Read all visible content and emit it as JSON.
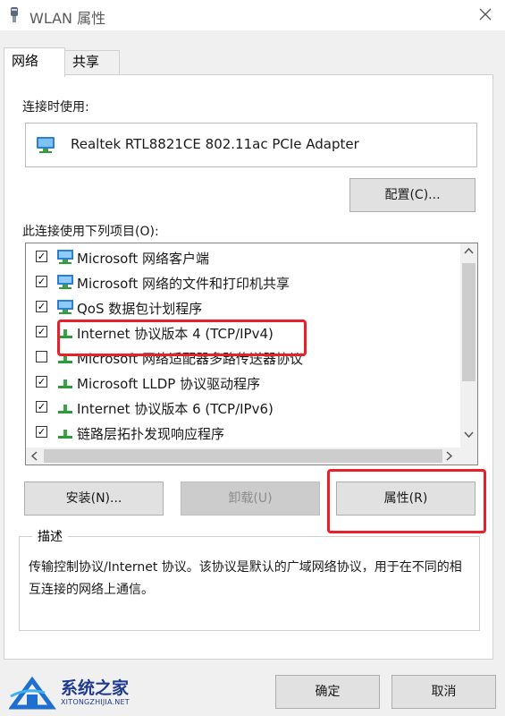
{
  "window": {
    "title": "WLAN 属性"
  },
  "tabs": [
    {
      "label": "网络",
      "active": true
    },
    {
      "label": "共享",
      "active": false
    }
  ],
  "connect_using_label": "连接时使用:",
  "adapter": {
    "name": "Realtek RTL8821CE 802.11ac PCIe Adapter",
    "icon": "network-adapter-icon"
  },
  "configure_button": "配置(C)...",
  "items_label": "此连接使用下列项目(O):",
  "items": [
    {
      "label": "Microsoft 网络客户端",
      "checked": true,
      "icon": "network-client-icon"
    },
    {
      "label": "Microsoft 网络的文件和打印机共享",
      "checked": true,
      "icon": "file-printer-sharing-icon"
    },
    {
      "label": "QoS 数据包计划程序",
      "checked": true,
      "icon": "qos-icon"
    },
    {
      "label": "Internet 协议版本 4 (TCP/IPv4)",
      "checked": true,
      "icon": "protocol-icon"
    },
    {
      "label": "Microsoft 网络适配器多路传送器协议",
      "checked": false,
      "icon": "protocol-icon"
    },
    {
      "label": "Microsoft LLDP 协议驱动程序",
      "checked": true,
      "icon": "protocol-icon"
    },
    {
      "label": "Internet 协议版本 6 (TCP/IPv6)",
      "checked": true,
      "icon": "protocol-icon"
    },
    {
      "label": "链路层拓扑发现响应程序",
      "checked": true,
      "icon": "protocol-icon"
    }
  ],
  "buttons": {
    "install": "安装(N)...",
    "uninstall": "卸载(U)",
    "properties": "属性(R)"
  },
  "description": {
    "legend": "描述",
    "text": "传输控制协议/Internet 协议。该协议是默认的广域网络协议，用于在不同的相互连接的网络上通信。"
  },
  "footer": {
    "ok": "确定",
    "cancel": "取消"
  },
  "watermark": {
    "brand": "系统之家",
    "url": "XITONGZHIJIA.NET"
  },
  "colors": {
    "highlight": "#e8202a",
    "accent": "#1f3a8f",
    "icon_green": "#2e9b3a",
    "icon_blue": "#1c6ec9"
  }
}
